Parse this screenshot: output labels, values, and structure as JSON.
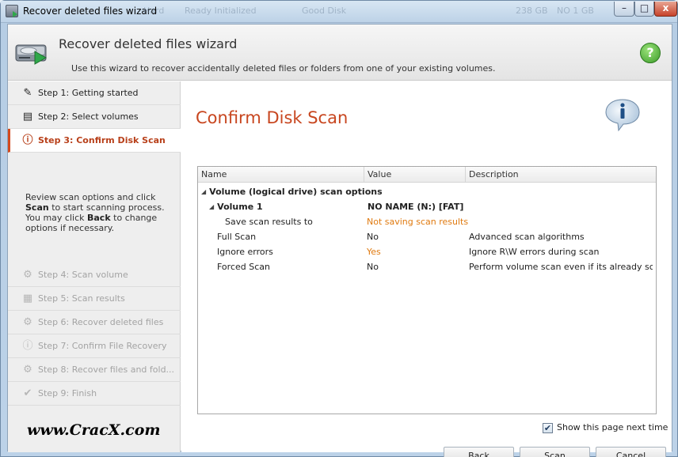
{
  "window": {
    "title": "Recover deleted files wizard",
    "ghost_titles": [
      "Hard",
      "Ready Initialized",
      "Good Disk",
      "238 GB",
      "NO 1 GB"
    ],
    "controls": {
      "minimize": "–",
      "maximize": "□",
      "close": "x"
    }
  },
  "header": {
    "title": "Recover deleted files wizard",
    "subtitle": "Use this wizard to recover accidentally deleted files or folders from one of your existing volumes.",
    "help_symbol": "?"
  },
  "sidebar": {
    "steps": [
      {
        "label": "Step 1: Getting started",
        "icon": "magic-wand-icon",
        "glyph": "✎",
        "state": "done"
      },
      {
        "label": "Step 2: Select volumes",
        "icon": "drive-icon",
        "glyph": "▤",
        "state": "done"
      },
      {
        "label": "Step 3: Confirm Disk Scan",
        "icon": "info-icon",
        "glyph": "ⓘ",
        "state": "active"
      },
      {
        "label": "Step 4: Scan volume",
        "icon": "gear-icon",
        "glyph": "⚙",
        "state": "disabled"
      },
      {
        "label": "Step 5: Scan results",
        "icon": "document-icon",
        "glyph": "▦",
        "state": "disabled"
      },
      {
        "label": "Step 6: Recover deleted files",
        "icon": "gear-icon",
        "glyph": "⚙",
        "state": "disabled"
      },
      {
        "label": "Step 7: Confirm File Recovery",
        "icon": "info-icon",
        "glyph": "ⓘ",
        "state": "disabled"
      },
      {
        "label": "Step 8: Recover files and fold...",
        "icon": "gear-icon",
        "glyph": "⚙",
        "state": "disabled"
      },
      {
        "label": "Step 9: Finish",
        "icon": "checkmark-icon",
        "glyph": "✔",
        "state": "disabled"
      }
    ],
    "description": {
      "line1": "Review scan options and click",
      "scan_word": "Scan",
      "line2_rest": " to start scanning process.",
      "line3_pre": "You may click ",
      "back_word": "Back",
      "line3_rest": " to change",
      "line4": "options if necessary."
    },
    "watermark": "www.CracX.com"
  },
  "main": {
    "title": "Confirm Disk Scan",
    "table": {
      "columns": [
        "Name",
        "Value",
        "Description"
      ],
      "group_label": "Volume (logical drive) scan options",
      "rows": [
        {
          "name": "Volume 1",
          "value": "NO NAME (N:) [FAT]",
          "description": ""
        },
        {
          "name": "Save scan results to",
          "value": "Not saving scan results",
          "description": ""
        },
        {
          "name": "Full Scan",
          "value": "No",
          "description": "Advanced scan algorithms"
        },
        {
          "name": "Ignore errors",
          "value": "Yes",
          "description": "Ignore R\\W errors during scan"
        },
        {
          "name": "Forced Scan",
          "value": "No",
          "description": "Perform volume scan even if its already sc..."
        }
      ]
    },
    "show_next_time": {
      "label": "Show this page next time",
      "checked": true,
      "glyph": "✔"
    },
    "buttons": {
      "back": "Back",
      "scan": "Scan",
      "cancel": "Cancel"
    }
  },
  "colors": {
    "accent": "#c8461f",
    "value_highlight": "#e07a10",
    "help_green": "#3c9c2a"
  }
}
